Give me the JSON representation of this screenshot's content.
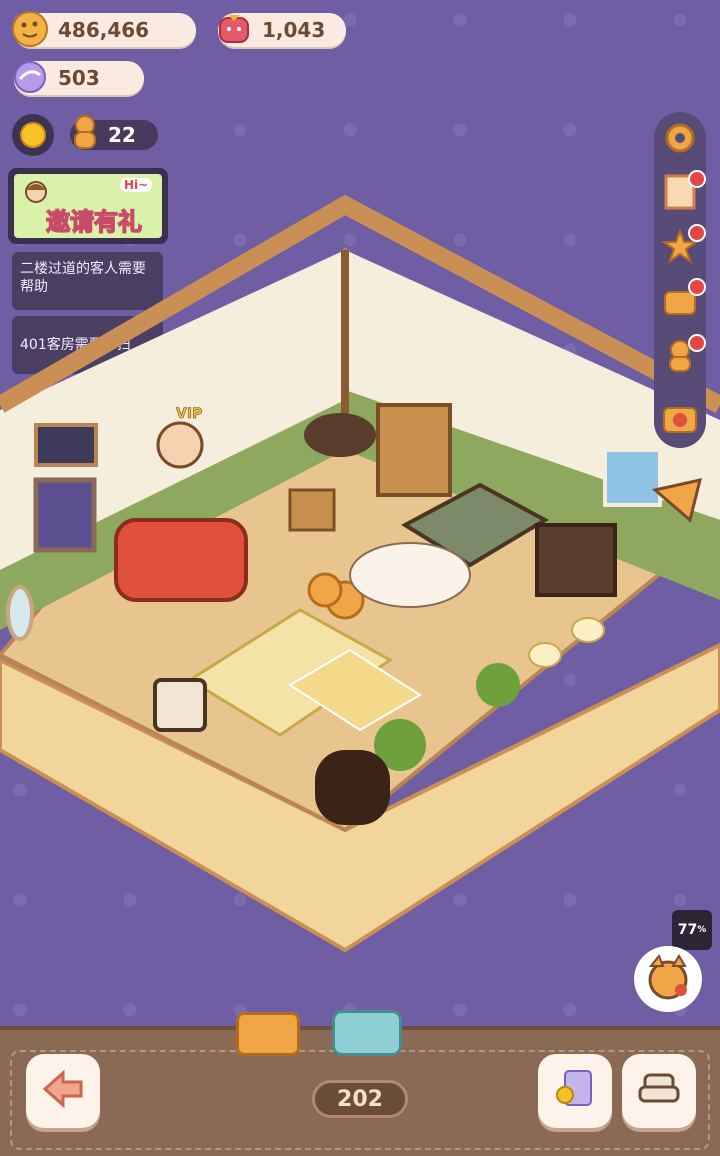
{
  "currency": {
    "cookies": "486,466",
    "gems": "1,043",
    "candy": "503",
    "helpers": "22"
  },
  "invite_banner": {
    "label": "邀请有礼",
    "bubble": "Hi~"
  },
  "tasks": [
    {
      "text": "二楼过道的客人需要帮助"
    },
    {
      "text": "401客房需要打扫"
    }
  ],
  "room": {
    "vip_label": "VIP"
  },
  "side_menu": [
    {
      "icon": "gear-icon"
    },
    {
      "icon": "stamp-icon"
    },
    {
      "icon": "star-badge-icon"
    },
    {
      "icon": "bag-icon"
    },
    {
      "icon": "gingerbread-icon"
    },
    {
      "icon": "camera-icon"
    }
  ],
  "battery": {
    "value": "77",
    "unit": "%"
  },
  "bottom": {
    "room_number": "202"
  },
  "colors": {
    "background": "#6f5ea3",
    "accent": "#f0a73a",
    "alert": "#e64545"
  }
}
